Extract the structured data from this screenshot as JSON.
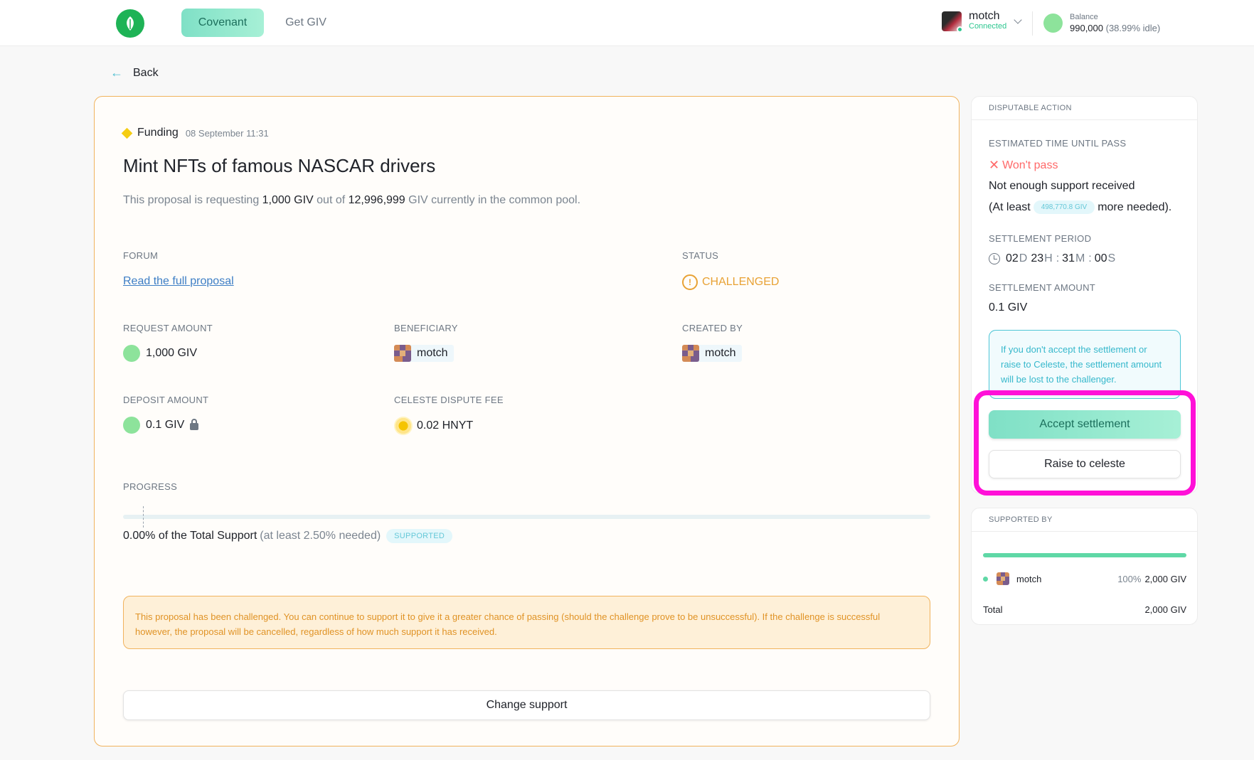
{
  "header": {
    "tabs": [
      {
        "label": "Covenant",
        "active": true
      },
      {
        "label": "Get GIV",
        "active": false
      }
    ],
    "account": {
      "name": "motch",
      "status": "Connected"
    },
    "balance": {
      "label": "Balance",
      "value": "990,000",
      "idle": "(38.99% idle)"
    }
  },
  "back_label": "Back",
  "proposal": {
    "type": "Funding",
    "date": "08 September 11:31",
    "title": "Mint NFTs of famous NASCAR drivers",
    "desc_prefix": "This proposal is requesting ",
    "desc_amount": "1,000 GIV",
    "desc_mid": " out of ",
    "desc_pool": "12,996,999",
    "desc_suffix": " GIV currently in the common pool.",
    "forum_label": "FORUM",
    "forum_link": "Read the full proposal",
    "status_label": "STATUS",
    "status_value": "CHALLENGED",
    "request_label": "REQUEST AMOUNT",
    "request_value": "1,000 GIV",
    "beneficiary_label": "BENEFICIARY",
    "beneficiary_value": "motch",
    "created_label": "CREATED BY",
    "created_value": "motch",
    "deposit_label": "DEPOSIT AMOUNT",
    "deposit_value": "0.1 GIV",
    "fee_label": "CELESTE DISPUTE FEE",
    "fee_value": "0.02 HNYT",
    "progress_label": "PROGRESS",
    "progress_main": "0.00% of the Total Support",
    "progress_needed": "(at least 2.50% needed)",
    "progress_badge": "SUPPORTED",
    "progress_fraction": 0.0,
    "threshold_fraction": 0.025,
    "alert": "This proposal has been challenged. You can continue to support it to give it a greater chance of passing (should the challenge prove to be unsuccessful). If the challenge is successful however, the proposal will be cancelled, regardless of how much support it has received.",
    "change_button": "Change support"
  },
  "disputable": {
    "header": "DISPUTABLE ACTION",
    "eta_label": "ESTIMATED TIME UNTIL PASS",
    "eta_value": "Won't pass",
    "reason": "Not enough support received",
    "needed_prefix": "(At least",
    "needed_amount": "498,770.8 GIV",
    "needed_suffix": "more needed).",
    "period_label": "SETTLEMENT PERIOD",
    "period": {
      "d": "02",
      "d_unit": "D",
      "h": "23",
      "h_unit": "H",
      "m": "31",
      "m_unit": "M",
      "s": "00",
      "s_unit": "S"
    },
    "amount_label": "SETTLEMENT AMOUNT",
    "amount_value": "0.1 GIV",
    "info": "If you don't accept the settlement or raise to Celeste, the settlement amount will be lost to the challenger.",
    "accept_button": "Accept settlement",
    "raise_button": "Raise to celeste"
  },
  "supported_by": {
    "header": "SUPPORTED BY",
    "supporters": [
      {
        "name": "motch",
        "pct": "100%",
        "amount": "2,000 GIV"
      }
    ],
    "total_label": "Total",
    "total_value": "2,000 GIV"
  },
  "colors": {
    "accent": "#7fe0c6",
    "warning": "#f1b35d",
    "highlight": "#ff10d8",
    "error": "#ff6969"
  }
}
